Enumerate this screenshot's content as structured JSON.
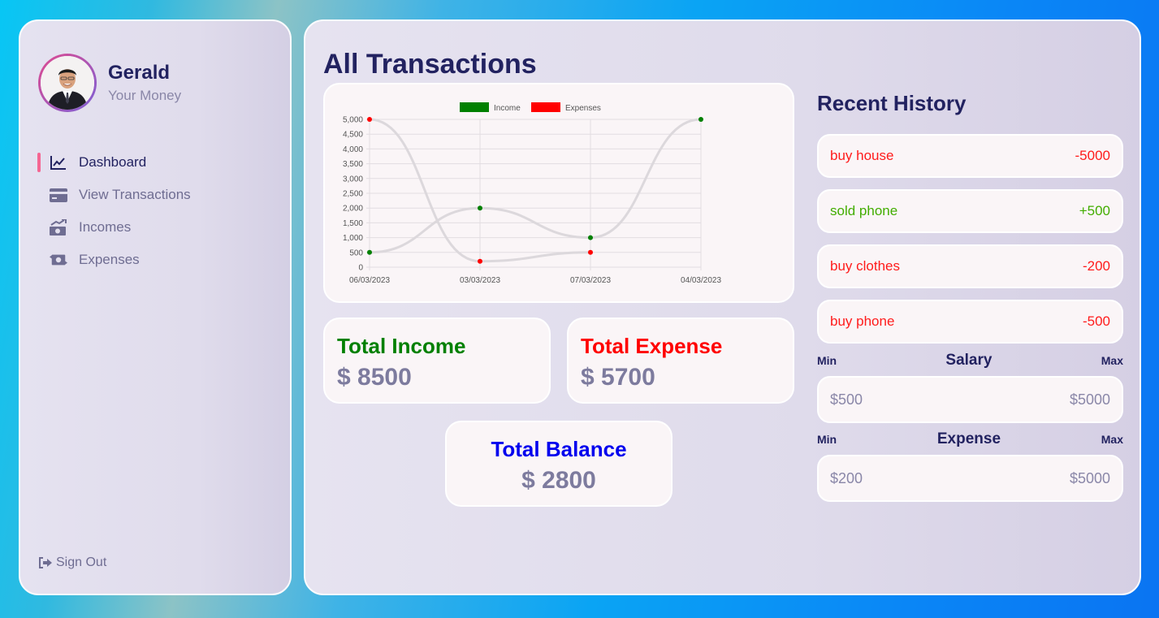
{
  "profile": {
    "name": "Gerald",
    "subtitle": "Your Money"
  },
  "nav": {
    "items": [
      {
        "label": "Dashboard",
        "icon": "chart-line-icon",
        "active": true
      },
      {
        "label": "View Transactions",
        "icon": "credit-card-icon",
        "active": false
      },
      {
        "label": "Incomes",
        "icon": "money-bill-trend-up-icon",
        "active": false
      },
      {
        "label": "Expenses",
        "icon": "money-bill-transfer-icon",
        "active": false
      }
    ],
    "signout": "Sign Out"
  },
  "main": {
    "title": "All Transactions"
  },
  "chart_data": {
    "type": "line",
    "categories": [
      "06/03/2023",
      "03/03/2023",
      "07/03/2023",
      "04/03/2023"
    ],
    "series": [
      {
        "name": "Income",
        "values": [
          500,
          2000,
          1000,
          5000
        ],
        "color": "#008000"
      },
      {
        "name": "Expenses",
        "values": [
          5000,
          200,
          500,
          null
        ],
        "color": "#ff0000"
      }
    ],
    "yticks": [
      "0",
      "500",
      "1,000",
      "1,500",
      "2,000",
      "2,500",
      "3,000",
      "3,500",
      "4,000",
      "4,500",
      "5,000"
    ],
    "ylim": [
      0,
      5000
    ],
    "legend": "top",
    "grid": true
  },
  "totals": {
    "income_label": "Total Income",
    "income_value": "$ 8500",
    "expense_label": "Total Expense",
    "expense_value": "$ 5700",
    "balance_label": "Total Balance",
    "balance_value": "$ 2800"
  },
  "history": {
    "title": "Recent History",
    "items": [
      {
        "title": "buy house",
        "amount": "-5000",
        "color": "#ff1b1b"
      },
      {
        "title": "sold phone",
        "amount": "+500",
        "color": "#42ad00"
      },
      {
        "title": "buy clothes",
        "amount": "-200",
        "color": "#ff1b1b"
      },
      {
        "title": "buy phone",
        "amount": "-500",
        "color": "#ff1b1b"
      }
    ]
  },
  "salary": {
    "min_label": "Min",
    "title": "Salary",
    "max_label": "Max",
    "min": "$500",
    "max": "$5000"
  },
  "expense_range": {
    "min_label": "Min",
    "title": "Expense",
    "max_label": "Max",
    "min": "$200",
    "max": "$5000"
  },
  "colors": {
    "navy": "#222260",
    "income": "#008000",
    "expense": "#ff0000",
    "balance": "#0000ee",
    "accent": "#f56692"
  }
}
